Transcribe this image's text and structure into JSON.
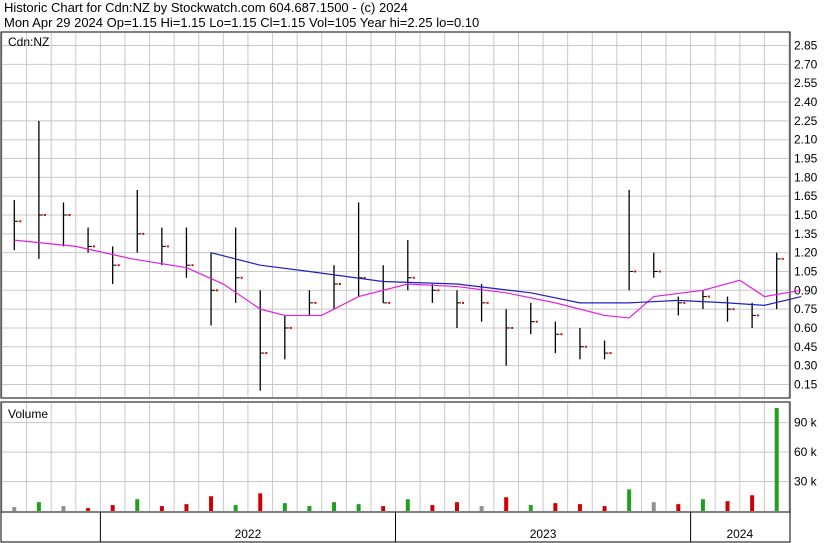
{
  "header": {
    "title": "Historic Chart for Cdn:NZ by Stockwatch.com 604.687.1500 - (c) 2024",
    "stats": "Mon Apr 29 2024  Op=1.15  Hi=1.15  Lo=1.15  Cl=1.15  Vol=105  Year hi=2.25  lo=0.10"
  },
  "price_panel": {
    "label": "Cdn:NZ"
  },
  "volume_panel": {
    "label": "Volume"
  },
  "colors": {
    "grid": "#c8c8c8",
    "price_bar": "#000000",
    "close_dot": "#e00000",
    "ma_short": "#e020e0",
    "ma_long": "#2020c0",
    "vol_up": "#20a020",
    "vol_down": "#d00000",
    "vol_flat": "#909090"
  },
  "chart_data": [
    {
      "type": "line",
      "title": "Historic Chart for Cdn:NZ",
      "ylabel": "Cdn:NZ",
      "ylim": [
        0.05,
        2.95
      ],
      "yticks": [
        "2.85",
        "2.70",
        "2.55",
        "2.40",
        "2.25",
        "2.10",
        "1.95",
        "1.80",
        "1.65",
        "1.50",
        "1.35",
        "1.20",
        "1.05",
        "0.90",
        "0.75",
        "0.60",
        "0.45",
        "0.30",
        "0.15"
      ],
      "xticks": [
        "2022",
        "2023",
        "2024"
      ],
      "xlim": [
        "2021-09",
        "2024-05"
      ],
      "grid": true,
      "price_bars": [
        {
          "x": "2021-09",
          "high": 1.62,
          "low": 1.22,
          "close": 1.45
        },
        {
          "x": "2021-10",
          "high": 2.25,
          "low": 1.15,
          "close": 1.5
        },
        {
          "x": "2021-11",
          "high": 1.6,
          "low": 1.25,
          "close": 1.5
        },
        {
          "x": "2021-12",
          "high": 1.4,
          "low": 1.2,
          "close": 1.25
        },
        {
          "x": "2022-01",
          "high": 1.25,
          "low": 0.95,
          "close": 1.1
        },
        {
          "x": "2022-02",
          "high": 1.7,
          "low": 1.2,
          "close": 1.35
        },
        {
          "x": "2022-03",
          "high": 1.4,
          "low": 1.1,
          "close": 1.25
        },
        {
          "x": "2022-04",
          "high": 1.4,
          "low": 1.0,
          "close": 1.1
        },
        {
          "x": "2022-05",
          "high": 1.2,
          "low": 0.62,
          "close": 0.9
        },
        {
          "x": "2022-06",
          "high": 1.4,
          "low": 0.8,
          "close": 1.0
        },
        {
          "x": "2022-07",
          "high": 0.9,
          "low": 0.1,
          "close": 0.4
        },
        {
          "x": "2022-08",
          "high": 0.7,
          "low": 0.35,
          "close": 0.6
        },
        {
          "x": "2022-09",
          "high": 0.9,
          "low": 0.7,
          "close": 0.8
        },
        {
          "x": "2022-10",
          "high": 1.1,
          "low": 0.75,
          "close": 0.95
        },
        {
          "x": "2022-11",
          "high": 1.6,
          "low": 0.85,
          "close": 1.0
        },
        {
          "x": "2022-12",
          "high": 1.1,
          "low": 0.8,
          "close": 0.8
        },
        {
          "x": "2023-01",
          "high": 1.3,
          "low": 0.9,
          "close": 1.0
        },
        {
          "x": "2023-02",
          "high": 0.95,
          "low": 0.8,
          "close": 0.9
        },
        {
          "x": "2023-03",
          "high": 0.9,
          "low": 0.6,
          "close": 0.8
        },
        {
          "x": "2023-04",
          "high": 0.95,
          "low": 0.65,
          "close": 0.8
        },
        {
          "x": "2023-05",
          "high": 0.75,
          "low": 0.3,
          "close": 0.6
        },
        {
          "x": "2023-06",
          "high": 0.8,
          "low": 0.55,
          "close": 0.65
        },
        {
          "x": "2023-07",
          "high": 0.65,
          "low": 0.4,
          "close": 0.55
        },
        {
          "x": "2023-08",
          "high": 0.6,
          "low": 0.35,
          "close": 0.45
        },
        {
          "x": "2023-09",
          "high": 0.5,
          "low": 0.35,
          "close": 0.4
        },
        {
          "x": "2023-10",
          "high": 1.7,
          "low": 0.9,
          "close": 1.05
        },
        {
          "x": "2023-11",
          "high": 1.2,
          "low": 1.0,
          "close": 1.05
        },
        {
          "x": "2023-12",
          "high": 0.85,
          "low": 0.7,
          "close": 0.8
        },
        {
          "x": "2024-01",
          "high": 0.9,
          "low": 0.75,
          "close": 0.85
        },
        {
          "x": "2024-02",
          "high": 0.85,
          "low": 0.65,
          "close": 0.75
        },
        {
          "x": "2024-03",
          "high": 0.8,
          "low": 0.6,
          "close": 0.7
        },
        {
          "x": "2024-04",
          "high": 1.2,
          "low": 0.75,
          "close": 1.15
        }
      ],
      "series": [
        {
          "values": [
            [
              0,
              1.3
            ],
            [
              2.5,
              1.25
            ],
            [
              4.8,
              1.15
            ],
            [
              7,
              1.08
            ],
            [
              8.5,
              0.95
            ],
            [
              10,
              0.75
            ],
            [
              11,
              0.7
            ],
            [
              12.5,
              0.7
            ],
            [
              14,
              0.85
            ],
            [
              16,
              0.95
            ],
            [
              18,
              0.93
            ],
            [
              20,
              0.88
            ],
            [
              22,
              0.8
            ],
            [
              24,
              0.7
            ],
            [
              25,
              0.68
            ],
            [
              26,
              0.85
            ],
            [
              28,
              0.9
            ],
            [
              29.5,
              0.98
            ],
            [
              30.5,
              0.85
            ],
            [
              32,
              0.9
            ]
          ]
        },
        {
          "values": [
            [
              8,
              1.2
            ],
            [
              10,
              1.1
            ],
            [
              12,
              1.05
            ],
            [
              15,
              0.97
            ],
            [
              18,
              0.95
            ],
            [
              21,
              0.88
            ],
            [
              23,
              0.8
            ],
            [
              25,
              0.8
            ],
            [
              27,
              0.82
            ],
            [
              29,
              0.8
            ],
            [
              30.5,
              0.78
            ],
            [
              32,
              0.85
            ]
          ]
        }
      ]
    },
    {
      "type": "bar",
      "title": "Volume",
      "ylim": [
        0,
        110000
      ],
      "yticks": [
        "90 k",
        "60 k",
        "30 k"
      ],
      "values": [
        4000,
        9000,
        5000,
        3000,
        6000,
        12000,
        5000,
        7000,
        15000,
        6000,
        18000,
        8000,
        5000,
        9000,
        7000,
        5000,
        12000,
        6000,
        9000,
        5000,
        14000,
        6000,
        8000,
        7000,
        5000,
        22000,
        9000,
        7000,
        12000,
        10000,
        16000,
        105000
      ]
    }
  ]
}
